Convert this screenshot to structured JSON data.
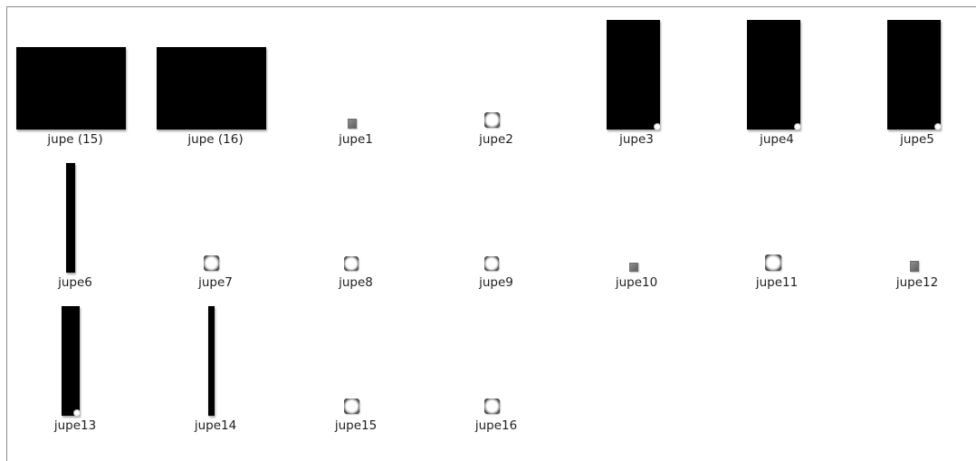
{
  "window": {
    "view": "large icons"
  },
  "files": [
    {
      "name": "jupe (15)",
      "thumbnail": "black-rectangle-landscape"
    },
    {
      "name": "jupe (16)",
      "thumbnail": "black-rectangle-landscape"
    },
    {
      "name": "jupe1",
      "thumbnail": "small-gray-square"
    },
    {
      "name": "jupe2",
      "thumbnail": "white-ring-square"
    },
    {
      "name": "jupe3",
      "thumbnail": "black-rectangle-portrait"
    },
    {
      "name": "jupe4",
      "thumbnail": "black-rectangle-portrait"
    },
    {
      "name": "jupe5",
      "thumbnail": "black-rectangle-portrait"
    },
    {
      "name": "jupe6",
      "thumbnail": "thin-black-bar"
    },
    {
      "name": "jupe7",
      "thumbnail": "white-ring-square"
    },
    {
      "name": "jupe8",
      "thumbnail": "white-ring-square"
    },
    {
      "name": "jupe9",
      "thumbnail": "white-ring-square"
    },
    {
      "name": "jupe10",
      "thumbnail": "small-gray-square"
    },
    {
      "name": "jupe11",
      "thumbnail": "white-ring-square"
    },
    {
      "name": "jupe12",
      "thumbnail": "small-gray-square"
    },
    {
      "name": "jupe13",
      "thumbnail": "black-rectangle-portrait"
    },
    {
      "name": "jupe14",
      "thumbnail": "thin-black-bar"
    },
    {
      "name": "jupe15",
      "thumbnail": "white-ring-square"
    },
    {
      "name": "jupe16",
      "thumbnail": "white-ring-square"
    }
  ]
}
